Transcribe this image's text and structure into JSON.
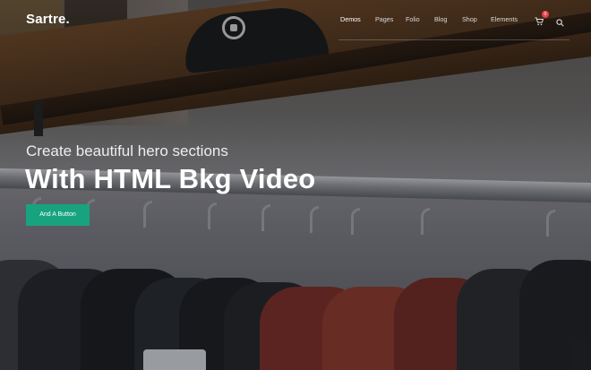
{
  "header": {
    "logo": "Sartre.",
    "nav": [
      "Demos",
      "Pages",
      "Folio",
      "Blog",
      "Shop",
      "Elements"
    ],
    "cart_count": "0"
  },
  "hero": {
    "subtitle": "Create beautiful hero sections",
    "title": "With HTML Bkg Video",
    "button": "And A Button"
  },
  "colors": {
    "accent": "#17a37f",
    "badge": "#e8414d"
  },
  "icons": [
    "cart-icon",
    "search-icon"
  ]
}
